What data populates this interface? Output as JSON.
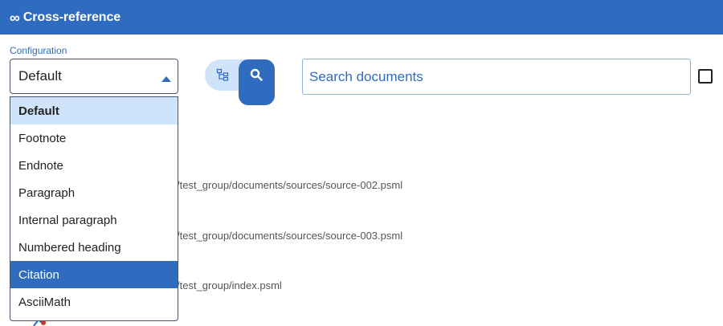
{
  "header": {
    "logo": "∞",
    "title": "Cross-reference"
  },
  "config": {
    "label": "Configuration",
    "selected_value": "Default",
    "options": [
      {
        "label": "Default",
        "state": "selected"
      },
      {
        "label": "Footnote",
        "state": ""
      },
      {
        "label": "Endnote",
        "state": ""
      },
      {
        "label": "Paragraph",
        "state": ""
      },
      {
        "label": "Internal paragraph",
        "state": ""
      },
      {
        "label": "Numbered heading",
        "state": ""
      },
      {
        "label": "Citation",
        "state": "highlighted"
      },
      {
        "label": "AsciiMath",
        "state": ""
      }
    ]
  },
  "search": {
    "placeholder": "Search documents",
    "value": ""
  },
  "results": [
    {
      "path": "/test_group/documents/sources/source-002.psml"
    },
    {
      "path": "/test_group/documents/sources/source-003.psml"
    },
    {
      "path": "/test_group/index.psml"
    }
  ],
  "icons": {
    "tree": "tree-view-icon",
    "search": "search-icon"
  },
  "colors": {
    "accent": "#2f6cbf",
    "accent_light": "#cfe3fa"
  }
}
